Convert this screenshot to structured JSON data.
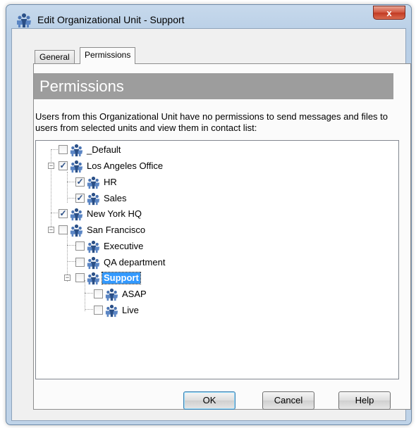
{
  "window": {
    "title": "Edit Organizational Unit - Support",
    "close_label": "x"
  },
  "tabs": [
    {
      "label": "General",
      "active": false
    },
    {
      "label": "Permissions",
      "active": true
    }
  ],
  "panel": {
    "header": "Permissions",
    "description": "Users from this Organizational Unit have no permissions to send messages and files to users from selected units and view them in contact list:"
  },
  "tree": [
    {
      "label": "_Default",
      "checked": false,
      "expander": ""
    },
    {
      "label": "Los Angeles Office",
      "checked": true,
      "expander": "−"
    },
    {
      "label": "HR",
      "checked": true,
      "expander": ""
    },
    {
      "label": "Sales",
      "checked": true,
      "expander": ""
    },
    {
      "label": "New York HQ",
      "checked": true,
      "expander": ""
    },
    {
      "label": "San Francisco",
      "checked": false,
      "expander": "−"
    },
    {
      "label": "Executive",
      "checked": false,
      "expander": ""
    },
    {
      "label": "QA department",
      "checked": false,
      "expander": ""
    },
    {
      "label": "Support",
      "checked": false,
      "expander": "−",
      "selected": true
    },
    {
      "label": "ASAP",
      "checked": false,
      "expander": ""
    },
    {
      "label": "Live",
      "checked": false,
      "expander": ""
    }
  ],
  "buttons": {
    "ok": "OK",
    "cancel": "Cancel",
    "help": "Help"
  },
  "colors": {
    "selection": "#3399ff",
    "header_bg": "#9d9d9d",
    "check_mark": "#2b4f86"
  },
  "icons": {
    "window": "org-unit-icon",
    "node": "org-unit-icon"
  }
}
